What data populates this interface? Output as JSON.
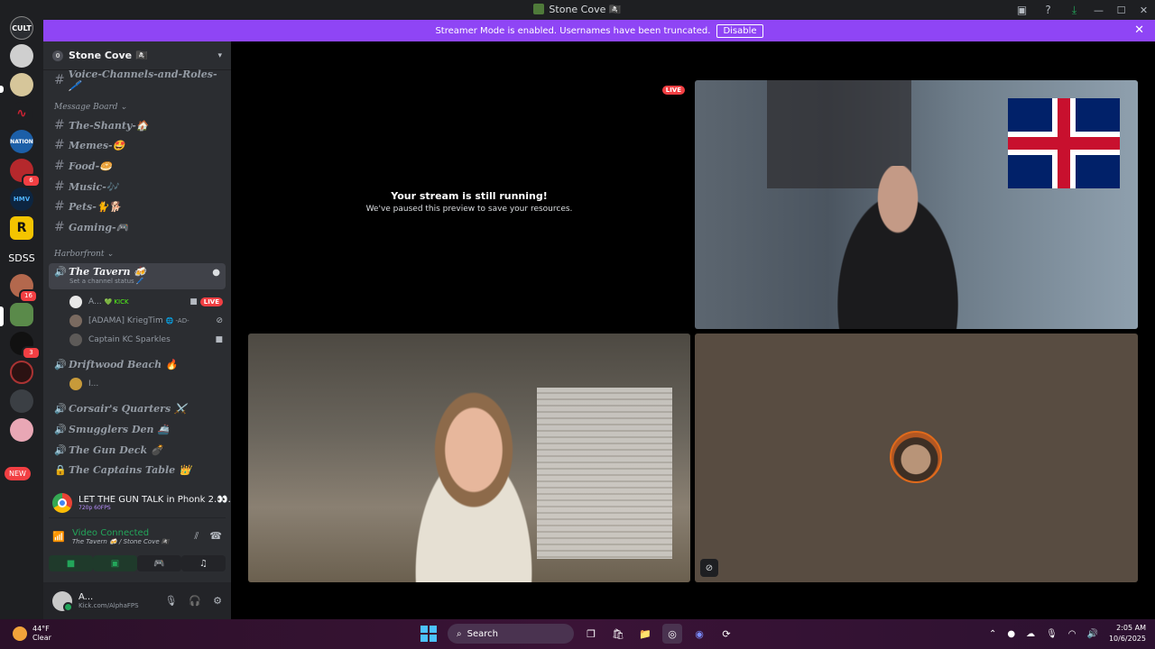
{
  "window": {
    "title": "Stone Cove 🏴‍☠️",
    "controls": {
      "minimize": "—",
      "maximize": "☐",
      "close": "✕"
    }
  },
  "banner": {
    "text": "Streamer Mode is enabled. Usernames have been truncated.",
    "button": "Disable"
  },
  "servers": {
    "text_item": "SDSS",
    "new_label": "NEW",
    "badges": [
      "6",
      "16",
      "3"
    ]
  },
  "guild": {
    "name": "Stone Cove 🏴‍☠️"
  },
  "channels": {
    "voice_channels_roles": "Voice-Channels-and-Roles-🖊️",
    "cat_message_board": "Message Board",
    "the_shanty": "The-Shanty-🏠",
    "memes": "Memes-🤩",
    "food": "Food-🥯",
    "music": "Music-🎶",
    "pets": "Pets-🐈🐕",
    "gaming": "Gaming-🎮",
    "cat_harborfront": "Harborfront",
    "the_tavern": "The Tavern 🍻",
    "tavern_status": "Set a channel status 🖊️",
    "tavern_users": [
      {
        "name": "A...",
        "tag": "💚 KICK",
        "live": "LIVE"
      },
      {
        "name": "[ADAMA] KriegTim",
        "tag": "🌐 -AD-"
      },
      {
        "name": "Captain KC Sparkles",
        "tag": ""
      }
    ],
    "driftwood_beach": "Driftwood Beach 🔥",
    "driftwood_user": "I...",
    "corsairs_quarters": "Corsair's Quarters ⚔️",
    "smugglers_den": "Smugglers Den 🚢",
    "the_gun_deck": "The Gun Deck 💣",
    "captains_table": "The Captains Table 👑"
  },
  "activity": {
    "title": "LET THE GUN TALK in Phonk 2.👀...",
    "sub": "720p 60FPS"
  },
  "voice_panel": {
    "title": "Video Connected",
    "sub": "The Tavern 🍻 / Stone Cove 🏴‍☠️"
  },
  "user": {
    "name": "A...",
    "status": "Kick.com/AlphaFPS"
  },
  "stage": {
    "paused_title": "Your stream is still running!",
    "paused_sub": "We've paused this preview to save your resources.",
    "live": "LIVE"
  },
  "taskbar": {
    "temp": "44°F",
    "weather": "Clear",
    "search": "Search",
    "time": "2:05 AM",
    "date": "10/6/2025"
  },
  "colors": {
    "banner": "#8f45f5",
    "live": "#f23f43",
    "connected": "#23a55a"
  }
}
